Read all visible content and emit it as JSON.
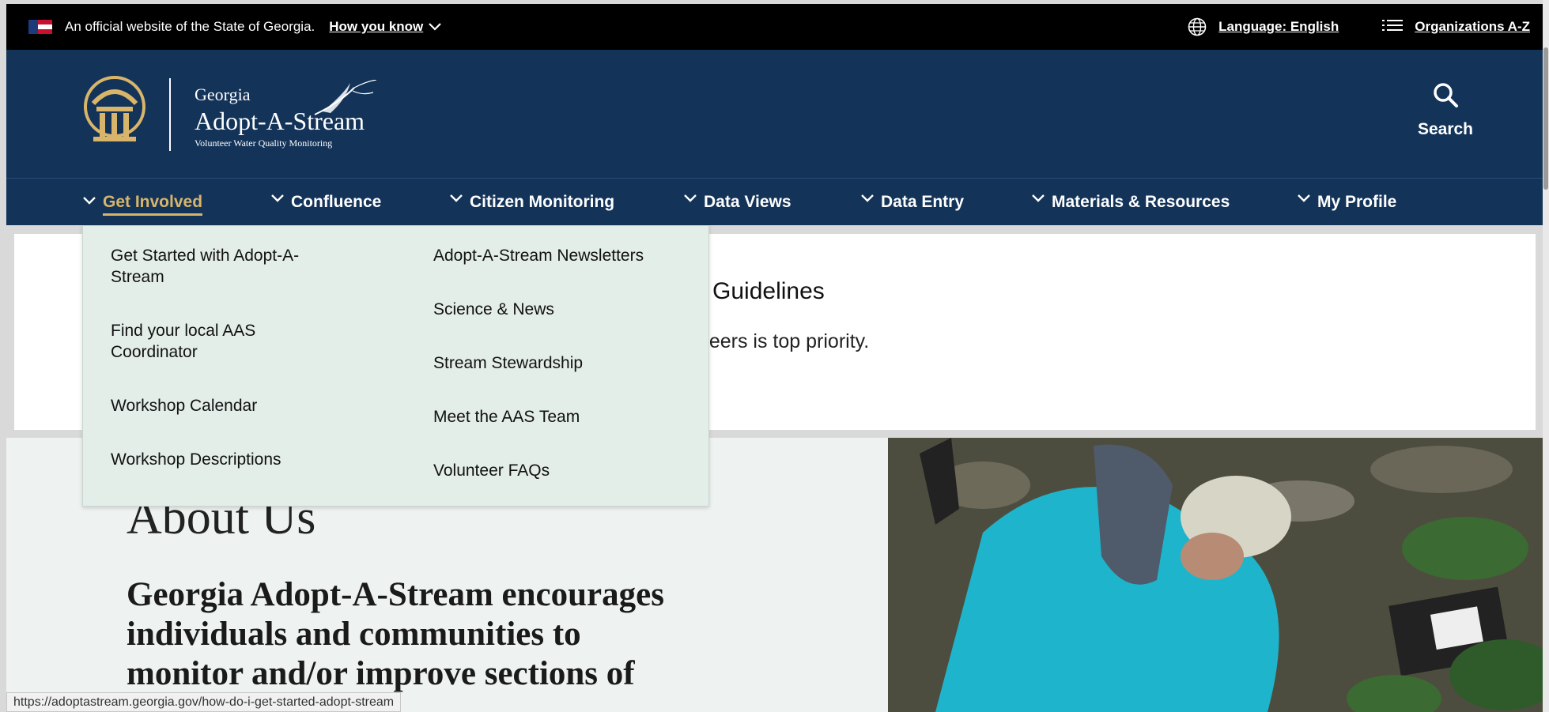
{
  "official_banner": {
    "text": "An official website of the State of Georgia.",
    "how_you_know": "How you know",
    "language": "Language: English",
    "organizations": "Organizations A-Z"
  },
  "header": {
    "brand_small": "Georgia",
    "brand_big": "Adopt-A-Stream",
    "brand_tag": "Volunteer Water Quality Monitoring",
    "search_label": "Search"
  },
  "nav": {
    "items": [
      {
        "label": "Get Involved"
      },
      {
        "label": "Confluence"
      },
      {
        "label": "Citizen Monitoring"
      },
      {
        "label": "Data Views"
      },
      {
        "label": "Data Entry"
      },
      {
        "label": "Materials & Resources"
      },
      {
        "label": "My Profile"
      }
    ]
  },
  "dropdown": {
    "col1": [
      "Get Started with Adopt-A-Stream",
      "Find your local AAS Coordinator",
      "Workshop Calendar",
      "Workshop Descriptions"
    ],
    "col2": [
      "Adopt-A-Stream Newsletters",
      "Science & News",
      "Stream Stewardship",
      "Meet the AAS Team",
      "Volunteer FAQs"
    ]
  },
  "banner": {
    "title_fragment": "g Guidelines",
    "text_fragment": "nteers is top priority."
  },
  "about": {
    "title": "About Us",
    "body": "Georgia Adopt-A-Stream encourages individuals and communities to monitor and/or improve sections of streams"
  },
  "status_url": "https://adoptastream.georgia.gov/how-do-i-get-started-adopt-stream"
}
